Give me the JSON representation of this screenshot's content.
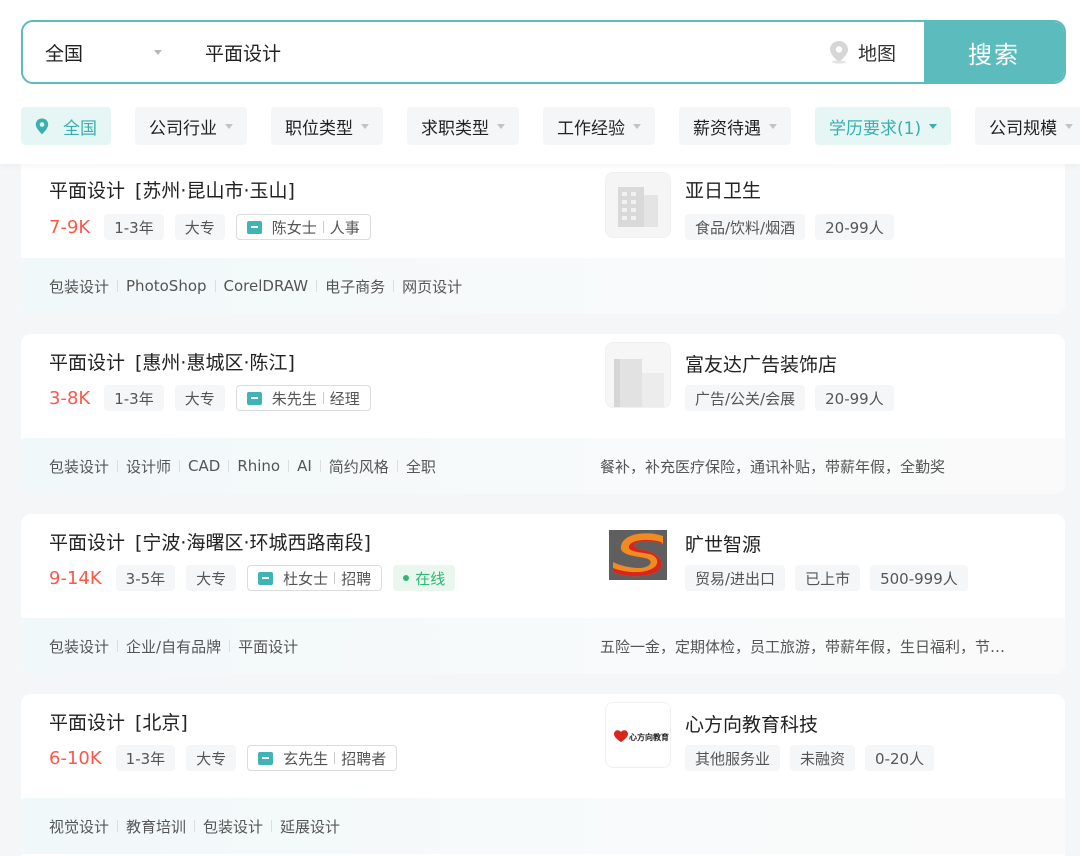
{
  "search": {
    "city": "全国",
    "query": "平面设计",
    "map_label": "地图",
    "button_label": "搜索"
  },
  "filters": {
    "city": "全国",
    "items": [
      "公司行业",
      "职位类型",
      "求职类型",
      "工作经验",
      "薪资待遇",
      "学历要求(1)",
      "公司规模"
    ]
  },
  "jobs": [
    {
      "title": "平面设计",
      "area": "[苏州·昆山市·玉山]",
      "salary": "7-9K",
      "tags": [
        "1-3年",
        "大专"
      ],
      "contact_name": "陈女士",
      "contact_role": "人事",
      "company": "亚日卫生",
      "company_tags": [
        "食品/饮料/烟酒",
        "20-99人"
      ],
      "skills": [
        "包装设计",
        "PhotoShop",
        "CorelDRAW",
        "电子商务",
        "网页设计"
      ],
      "welfare": ""
    },
    {
      "title": "平面设计",
      "area": "[惠州·惠城区·陈江]",
      "salary": "3-8K",
      "tags": [
        "1-3年",
        "大专"
      ],
      "contact_name": "朱先生",
      "contact_role": "经理",
      "company": "富友达广告装饰店",
      "company_tags": [
        "广告/公关/会展",
        "20-99人"
      ],
      "skills": [
        "包装设计",
        "设计师",
        "CAD",
        "Rhino",
        "AI",
        "简约风格",
        "全职"
      ],
      "welfare": "餐补，补充医疗保险，通讯补贴，带薪年假，全勤奖"
    },
    {
      "title": "平面设计",
      "area": "[宁波·海曙区·环城西路南段]",
      "salary": "9-14K",
      "tags": [
        "3-5年",
        "大专"
      ],
      "contact_name": "杜女士",
      "contact_role": "招聘",
      "online": "在线",
      "company": "旷世智源",
      "company_tags": [
        "贸易/进出口",
        "已上市",
        "500-999人"
      ],
      "skills": [
        "包装设计",
        "企业/自有品牌",
        "平面设计"
      ],
      "welfare": "五险一金，定期体检，员工旅游，带薪年假，生日福利，节…"
    },
    {
      "title": "平面设计",
      "area": "[北京]",
      "salary": "6-10K",
      "tags": [
        "1-3年",
        "大专"
      ],
      "contact_name": "玄先生",
      "contact_role": "招聘者",
      "company": "心方向教育科技",
      "company_tags": [
        "其他服务业",
        "未融资",
        "0-20人"
      ],
      "skills": [
        "视觉设计",
        "教育培训",
        "包装设计",
        "延展设计"
      ],
      "welfare": ""
    }
  ],
  "logo4_text": "心方向教育"
}
